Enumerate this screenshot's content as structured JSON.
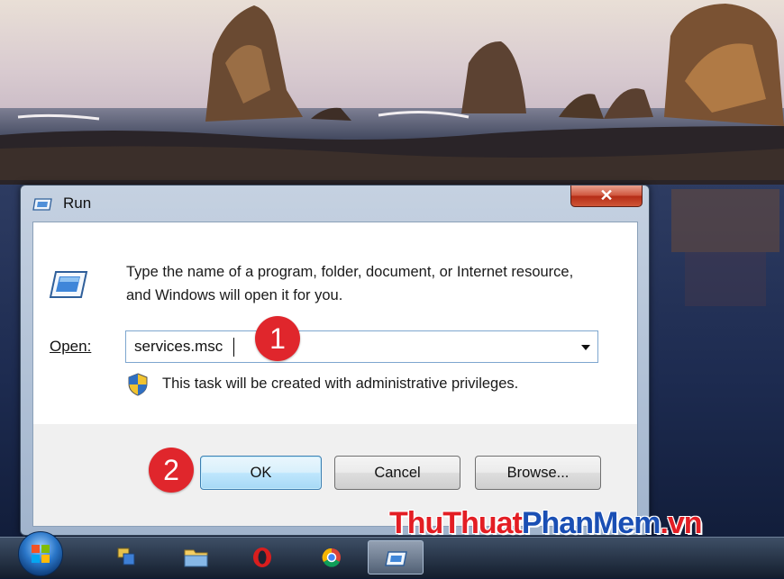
{
  "dialog": {
    "title": "Run",
    "description": "Type the name of a program, folder, document, or Internet resource, and Windows will open it for you.",
    "open_label": "Open:",
    "open_value": "services.msc",
    "admin_note": "This task will be created with administrative privileges.",
    "buttons": {
      "ok": "OK",
      "cancel": "Cancel",
      "browse": "Browse..."
    }
  },
  "annotations": {
    "step1": "1",
    "step2": "2"
  },
  "watermark": {
    "part1": "ThuThuat",
    "part2": "PhanMem",
    "part3": ".vn"
  },
  "taskbar": {
    "items": [
      "start-orb",
      "remote-desktop-icon",
      "file-explorer-icon",
      "opera-icon",
      "chrome-icon",
      "run-icon"
    ]
  },
  "colors": {
    "close_button": "#c94428",
    "badge": "#e0262c",
    "watermark_red": "#e31e24",
    "watermark_blue": "#1a4fb4"
  }
}
